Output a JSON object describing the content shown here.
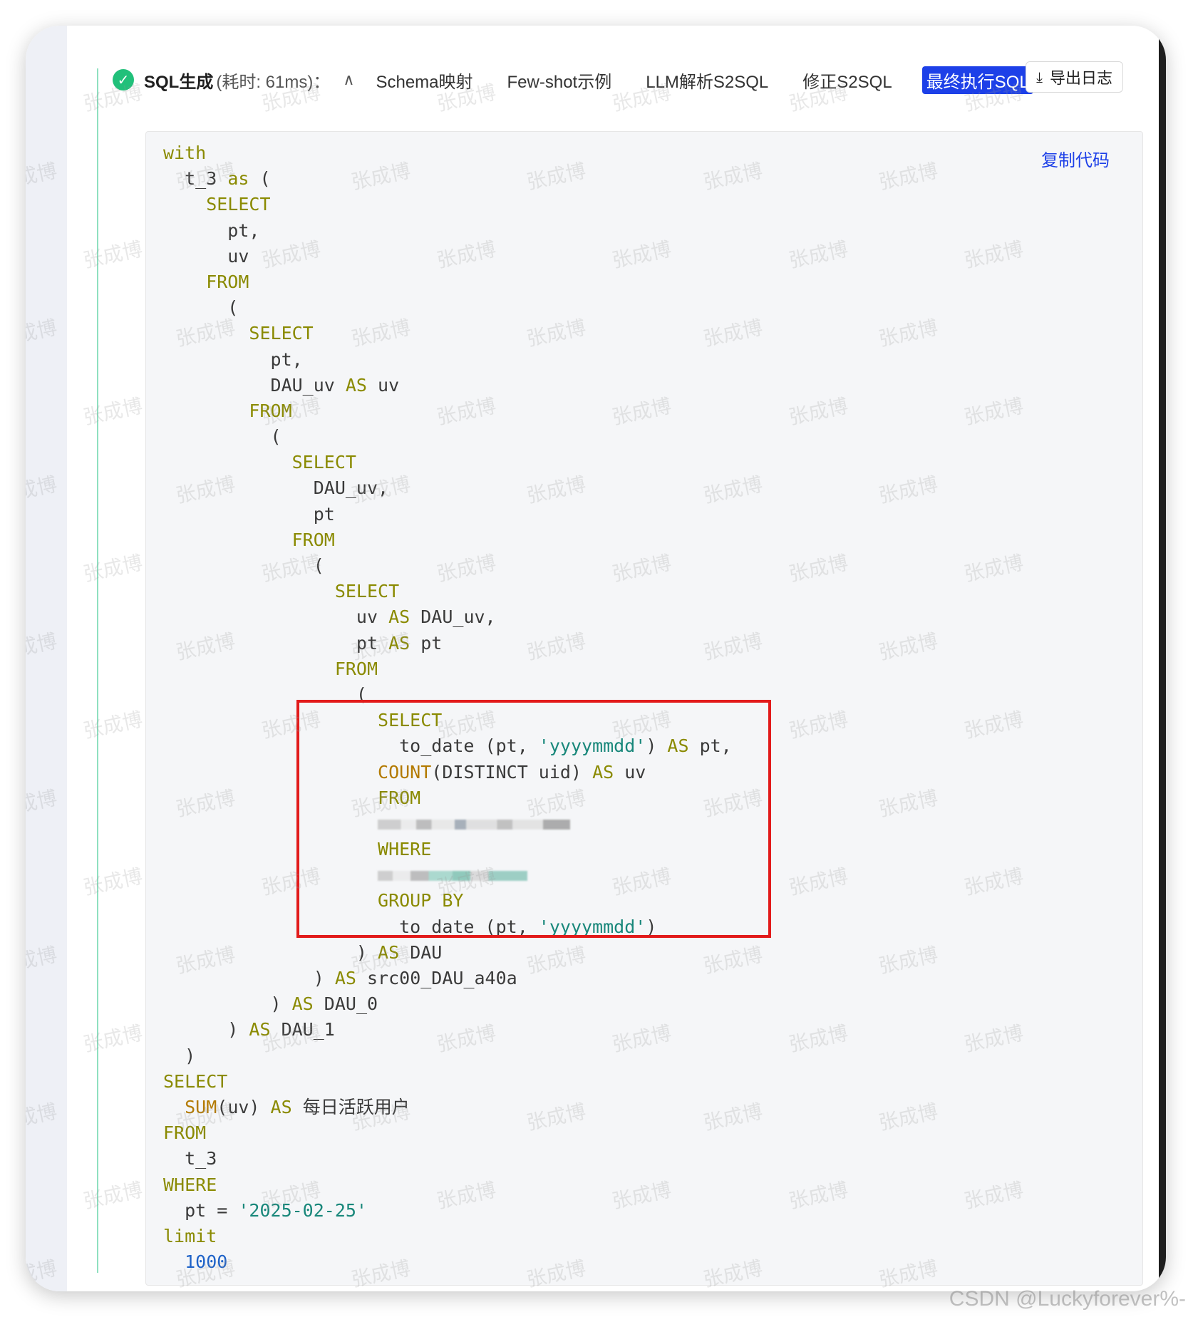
{
  "header": {
    "title": "SQL生成",
    "elapsed": "(耗时: 61ms)：",
    "tabs": [
      {
        "label": "Schema映射",
        "active": false
      },
      {
        "label": "Few-shot示例",
        "active": false
      },
      {
        "label": "LLM解析S2SQL",
        "active": false
      },
      {
        "label": "修正S2SQL",
        "active": false
      },
      {
        "label": "最终执行SQL",
        "active": true
      }
    ],
    "export_label": "导出日志"
  },
  "code_block": {
    "copy_label": "复制代码",
    "lines": [
      [
        [
          "kw",
          "with"
        ]
      ],
      [
        [
          "",
          "  t_3 "
        ],
        [
          "kw",
          "as"
        ],
        [
          "",
          " ("
        ]
      ],
      [
        [
          "kw",
          "    SELECT"
        ]
      ],
      [
        [
          "",
          "      pt,"
        ]
      ],
      [
        [
          "",
          "      uv"
        ]
      ],
      [
        [
          "kw",
          "    FROM"
        ]
      ],
      [
        [
          "",
          "      ("
        ]
      ],
      [
        [
          "kw",
          "        SELECT"
        ]
      ],
      [
        [
          "",
          "          pt,"
        ]
      ],
      [
        [
          "",
          "          DAU_uv "
        ],
        [
          "kw",
          "AS"
        ],
        [
          "",
          " uv"
        ]
      ],
      [
        [
          "kw",
          "        FROM"
        ]
      ],
      [
        [
          "",
          "          ("
        ]
      ],
      [
        [
          "kw",
          "            SELECT"
        ]
      ],
      [
        [
          "",
          "              DAU_uv,"
        ]
      ],
      [
        [
          "",
          "              pt"
        ]
      ],
      [
        [
          "kw",
          "            FROM"
        ]
      ],
      [
        [
          "",
          "              ("
        ]
      ],
      [
        [
          "kw",
          "                SELECT"
        ]
      ],
      [
        [
          "",
          "                  uv "
        ],
        [
          "kw",
          "AS"
        ],
        [
          "",
          " DAU_uv,"
        ]
      ],
      [
        [
          "",
          "                  pt "
        ],
        [
          "kw",
          "AS"
        ],
        [
          "",
          " pt"
        ]
      ],
      [
        [
          "kw",
          "                FROM"
        ]
      ],
      [
        [
          "",
          "                  ("
        ]
      ],
      [
        [
          "kw",
          "                    SELECT"
        ]
      ],
      [
        [
          "",
          "                      to_date (pt, "
        ],
        [
          "str",
          "'yyyymmdd'"
        ],
        [
          "",
          ") "
        ],
        [
          "kw",
          "AS"
        ],
        [
          "",
          " pt,"
        ]
      ],
      [
        [
          "fn",
          "                    COUNT"
        ],
        [
          "",
          "(DISTINCT uid) "
        ],
        [
          "kw",
          "AS"
        ],
        [
          "",
          " uv"
        ]
      ],
      [
        [
          "kw",
          "                    FROM"
        ]
      ],
      [
        [
          "blur1",
          ""
        ]
      ],
      [
        [
          "kw",
          "                    WHERE"
        ]
      ],
      [
        [
          "blur2",
          ""
        ]
      ],
      [
        [
          "kw",
          "                    GROUP BY"
        ]
      ],
      [
        [
          "",
          "                      to_date (pt, "
        ],
        [
          "str",
          "'yyyymmdd'"
        ],
        [
          "",
          ")"
        ]
      ],
      [
        [
          "",
          "                  ) "
        ],
        [
          "kw",
          "AS"
        ],
        [
          "",
          " DAU"
        ]
      ],
      [
        [
          "",
          "              ) "
        ],
        [
          "kw",
          "AS"
        ],
        [
          "",
          " src00_DAU_a40a"
        ]
      ],
      [
        [
          "",
          "          ) "
        ],
        [
          "kw",
          "AS"
        ],
        [
          "",
          " DAU_0"
        ]
      ],
      [
        [
          "",
          "      ) "
        ],
        [
          "kw",
          "AS"
        ],
        [
          "",
          " DAU_1"
        ]
      ],
      [
        [
          "",
          "  )"
        ]
      ],
      [
        [
          "kw",
          "SELECT"
        ]
      ],
      [
        [
          "fn",
          "  SUM"
        ],
        [
          "",
          "(uv) "
        ],
        [
          "kw",
          "AS"
        ],
        [
          "",
          " 每日活跃用户"
        ]
      ],
      [
        [
          "kw",
          "FROM"
        ]
      ],
      [
        [
          "",
          "  t_3"
        ]
      ],
      [
        [
          "kw",
          "WHERE"
        ]
      ],
      [
        [
          "",
          "  pt = "
        ],
        [
          "str",
          "'2025-02-25'"
        ]
      ],
      [
        [
          "kw",
          "limit"
        ]
      ],
      [
        [
          "num",
          "  1000"
        ]
      ]
    ]
  },
  "watermark_text": "张成博",
  "footer_credit": "CSDN @Luckyforever%-"
}
